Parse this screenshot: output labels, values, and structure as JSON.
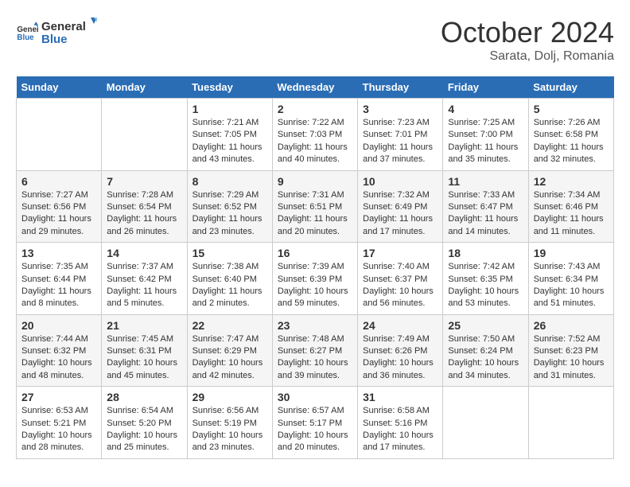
{
  "header": {
    "logo_general": "General",
    "logo_blue": "Blue",
    "month": "October 2024",
    "location": "Sarata, Dolj, Romania"
  },
  "days_of_week": [
    "Sunday",
    "Monday",
    "Tuesday",
    "Wednesday",
    "Thursday",
    "Friday",
    "Saturday"
  ],
  "weeks": [
    [
      {
        "day": "",
        "sunrise": "",
        "sunset": "",
        "daylight": ""
      },
      {
        "day": "",
        "sunrise": "",
        "sunset": "",
        "daylight": ""
      },
      {
        "day": "1",
        "sunrise": "Sunrise: 7:21 AM",
        "sunset": "Sunset: 7:05 PM",
        "daylight": "Daylight: 11 hours and 43 minutes."
      },
      {
        "day": "2",
        "sunrise": "Sunrise: 7:22 AM",
        "sunset": "Sunset: 7:03 PM",
        "daylight": "Daylight: 11 hours and 40 minutes."
      },
      {
        "day": "3",
        "sunrise": "Sunrise: 7:23 AM",
        "sunset": "Sunset: 7:01 PM",
        "daylight": "Daylight: 11 hours and 37 minutes."
      },
      {
        "day": "4",
        "sunrise": "Sunrise: 7:25 AM",
        "sunset": "Sunset: 7:00 PM",
        "daylight": "Daylight: 11 hours and 35 minutes."
      },
      {
        "day": "5",
        "sunrise": "Sunrise: 7:26 AM",
        "sunset": "Sunset: 6:58 PM",
        "daylight": "Daylight: 11 hours and 32 minutes."
      }
    ],
    [
      {
        "day": "6",
        "sunrise": "Sunrise: 7:27 AM",
        "sunset": "Sunset: 6:56 PM",
        "daylight": "Daylight: 11 hours and 29 minutes."
      },
      {
        "day": "7",
        "sunrise": "Sunrise: 7:28 AM",
        "sunset": "Sunset: 6:54 PM",
        "daylight": "Daylight: 11 hours and 26 minutes."
      },
      {
        "day": "8",
        "sunrise": "Sunrise: 7:29 AM",
        "sunset": "Sunset: 6:52 PM",
        "daylight": "Daylight: 11 hours and 23 minutes."
      },
      {
        "day": "9",
        "sunrise": "Sunrise: 7:31 AM",
        "sunset": "Sunset: 6:51 PM",
        "daylight": "Daylight: 11 hours and 20 minutes."
      },
      {
        "day": "10",
        "sunrise": "Sunrise: 7:32 AM",
        "sunset": "Sunset: 6:49 PM",
        "daylight": "Daylight: 11 hours and 17 minutes."
      },
      {
        "day": "11",
        "sunrise": "Sunrise: 7:33 AM",
        "sunset": "Sunset: 6:47 PM",
        "daylight": "Daylight: 11 hours and 14 minutes."
      },
      {
        "day": "12",
        "sunrise": "Sunrise: 7:34 AM",
        "sunset": "Sunset: 6:46 PM",
        "daylight": "Daylight: 11 hours and 11 minutes."
      }
    ],
    [
      {
        "day": "13",
        "sunrise": "Sunrise: 7:35 AM",
        "sunset": "Sunset: 6:44 PM",
        "daylight": "Daylight: 11 hours and 8 minutes."
      },
      {
        "day": "14",
        "sunrise": "Sunrise: 7:37 AM",
        "sunset": "Sunset: 6:42 PM",
        "daylight": "Daylight: 11 hours and 5 minutes."
      },
      {
        "day": "15",
        "sunrise": "Sunrise: 7:38 AM",
        "sunset": "Sunset: 6:40 PM",
        "daylight": "Daylight: 11 hours and 2 minutes."
      },
      {
        "day": "16",
        "sunrise": "Sunrise: 7:39 AM",
        "sunset": "Sunset: 6:39 PM",
        "daylight": "Daylight: 10 hours and 59 minutes."
      },
      {
        "day": "17",
        "sunrise": "Sunrise: 7:40 AM",
        "sunset": "Sunset: 6:37 PM",
        "daylight": "Daylight: 10 hours and 56 minutes."
      },
      {
        "day": "18",
        "sunrise": "Sunrise: 7:42 AM",
        "sunset": "Sunset: 6:35 PM",
        "daylight": "Daylight: 10 hours and 53 minutes."
      },
      {
        "day": "19",
        "sunrise": "Sunrise: 7:43 AM",
        "sunset": "Sunset: 6:34 PM",
        "daylight": "Daylight: 10 hours and 51 minutes."
      }
    ],
    [
      {
        "day": "20",
        "sunrise": "Sunrise: 7:44 AM",
        "sunset": "Sunset: 6:32 PM",
        "daylight": "Daylight: 10 hours and 48 minutes."
      },
      {
        "day": "21",
        "sunrise": "Sunrise: 7:45 AM",
        "sunset": "Sunset: 6:31 PM",
        "daylight": "Daylight: 10 hours and 45 minutes."
      },
      {
        "day": "22",
        "sunrise": "Sunrise: 7:47 AM",
        "sunset": "Sunset: 6:29 PM",
        "daylight": "Daylight: 10 hours and 42 minutes."
      },
      {
        "day": "23",
        "sunrise": "Sunrise: 7:48 AM",
        "sunset": "Sunset: 6:27 PM",
        "daylight": "Daylight: 10 hours and 39 minutes."
      },
      {
        "day": "24",
        "sunrise": "Sunrise: 7:49 AM",
        "sunset": "Sunset: 6:26 PM",
        "daylight": "Daylight: 10 hours and 36 minutes."
      },
      {
        "day": "25",
        "sunrise": "Sunrise: 7:50 AM",
        "sunset": "Sunset: 6:24 PM",
        "daylight": "Daylight: 10 hours and 34 minutes."
      },
      {
        "day": "26",
        "sunrise": "Sunrise: 7:52 AM",
        "sunset": "Sunset: 6:23 PM",
        "daylight": "Daylight: 10 hours and 31 minutes."
      }
    ],
    [
      {
        "day": "27",
        "sunrise": "Sunrise: 6:53 AM",
        "sunset": "Sunset: 5:21 PM",
        "daylight": "Daylight: 10 hours and 28 minutes."
      },
      {
        "day": "28",
        "sunrise": "Sunrise: 6:54 AM",
        "sunset": "Sunset: 5:20 PM",
        "daylight": "Daylight: 10 hours and 25 minutes."
      },
      {
        "day": "29",
        "sunrise": "Sunrise: 6:56 AM",
        "sunset": "Sunset: 5:19 PM",
        "daylight": "Daylight: 10 hours and 23 minutes."
      },
      {
        "day": "30",
        "sunrise": "Sunrise: 6:57 AM",
        "sunset": "Sunset: 5:17 PM",
        "daylight": "Daylight: 10 hours and 20 minutes."
      },
      {
        "day": "31",
        "sunrise": "Sunrise: 6:58 AM",
        "sunset": "Sunset: 5:16 PM",
        "daylight": "Daylight: 10 hours and 17 minutes."
      },
      {
        "day": "",
        "sunrise": "",
        "sunset": "",
        "daylight": ""
      },
      {
        "day": "",
        "sunrise": "",
        "sunset": "",
        "daylight": ""
      }
    ]
  ]
}
